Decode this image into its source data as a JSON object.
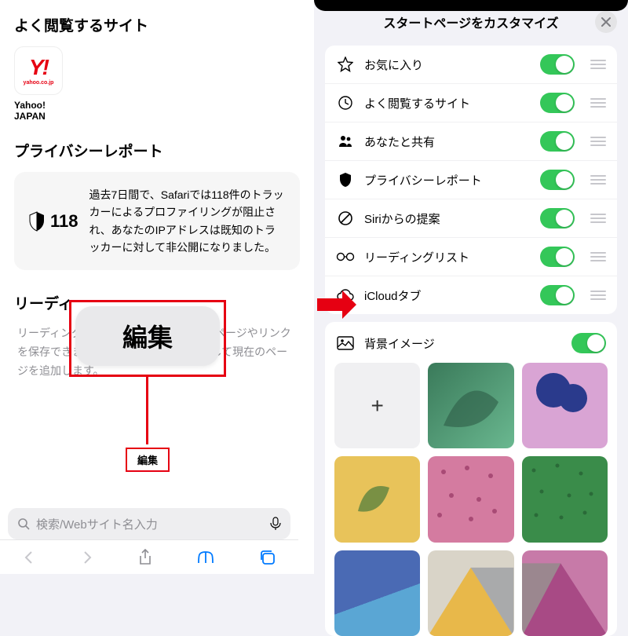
{
  "left": {
    "frequently_visited": "よく閲覧するサイト",
    "fav": {
      "logo_text": "Y!",
      "logo_sub": "yahoo.co.jp",
      "label": "Yahoo!\nJAPAN"
    },
    "privacy_title": "プライバシーレポート",
    "privacy_count": "118",
    "privacy_text": "過去7日間で、Safariでは118件のトラッカーによるプロファイリングが阻止され、あなたのIPアドレスは既知のトラッカーに対して非公開になりました。",
    "reading_title": "リーディ",
    "reading_desc": "リーディングリストには、後で読みたいページやリンクを保存できます。\"共有\"ボタンをタップして現在のページを追加します。",
    "popup_label": "編集",
    "edit_small": "編集",
    "search_placeholder": "検索/Webサイト名入力"
  },
  "right": {
    "title": "スタートページをカスタマイズ",
    "items": [
      {
        "icon": "star",
        "label": "お気に入り"
      },
      {
        "icon": "clock",
        "label": "よく閲覧するサイト"
      },
      {
        "icon": "people",
        "label": "あなたと共有"
      },
      {
        "icon": "shield",
        "label": "プライバシーレポート"
      },
      {
        "icon": "nosign",
        "label": "Siriからの提案"
      },
      {
        "icon": "glasses",
        "label": "リーディングリスト"
      },
      {
        "icon": "cloud",
        "label": "iCloudタブ"
      }
    ],
    "bg_label": "背景イメージ",
    "add_label": "+"
  }
}
